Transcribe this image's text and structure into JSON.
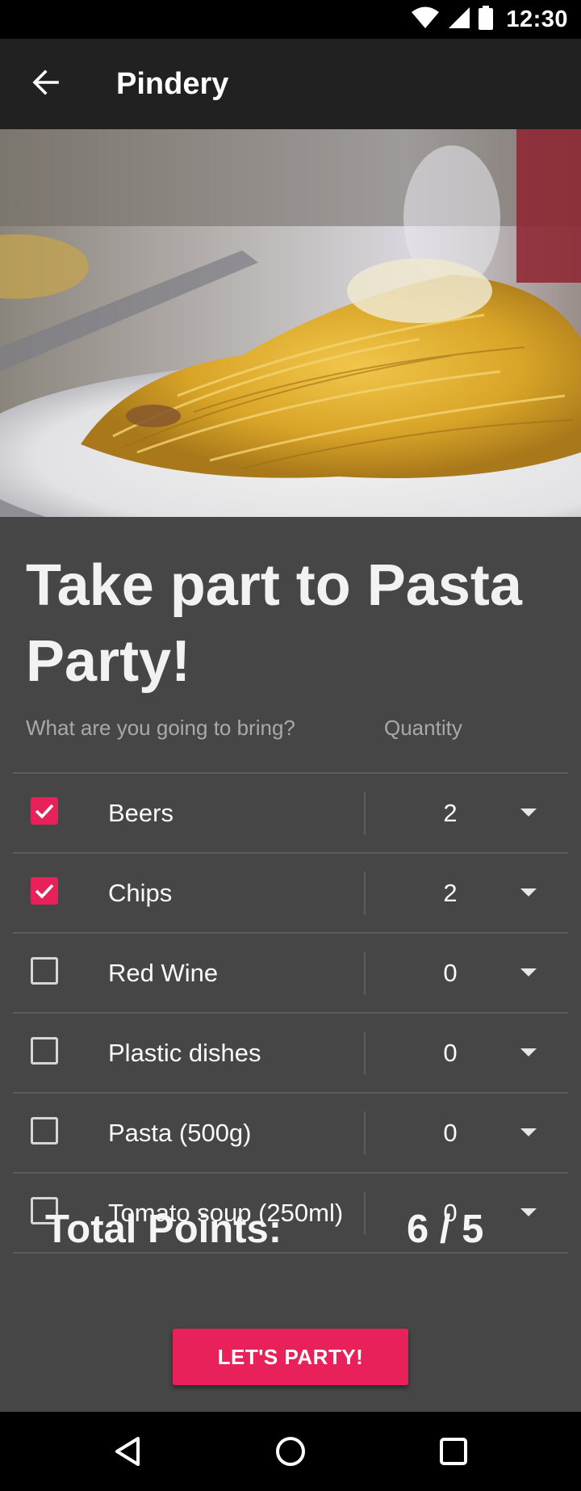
{
  "status_bar": {
    "time": "12:30",
    "icons": [
      "wifi-icon",
      "signal-icon",
      "battery-icon"
    ]
  },
  "app_bar": {
    "title": "Pindery",
    "back_icon": "arrow-back-icon"
  },
  "hero_image": {
    "description_icon": "pasta-photo"
  },
  "form": {
    "headline": "Take part to Pasta Party!",
    "item_column_label": "What are you going to bring?",
    "quantity_column_label": "Quantity",
    "items": [
      {
        "label": "Beers",
        "checked": true,
        "quantity": "2"
      },
      {
        "label": "Chips",
        "checked": true,
        "quantity": "2"
      },
      {
        "label": "Red Wine",
        "checked": false,
        "quantity": "0"
      },
      {
        "label": "Plastic dishes",
        "checked": false,
        "quantity": "0"
      },
      {
        "label": "Pasta (500g)",
        "checked": false,
        "quantity": "0"
      },
      {
        "label": "Tomato soup (250ml)",
        "checked": false,
        "quantity": "0"
      }
    ],
    "total_label": "Total Points:",
    "total_value": "6 / 5",
    "submit_label": "LET'S PARTY!"
  },
  "colors": {
    "accent": "#e8215a",
    "app_bar": "#212121",
    "content_bg": "#464646"
  },
  "nav_bar": {
    "icons": [
      "back-triangle-icon",
      "home-circle-icon",
      "recents-square-icon"
    ]
  }
}
